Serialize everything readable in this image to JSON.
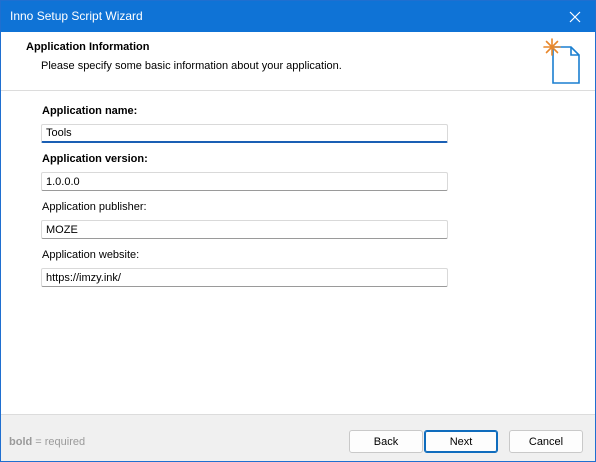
{
  "window": {
    "title": "Inno Setup Script Wizard",
    "close_icon": "close-icon"
  },
  "header": {
    "title": "Application Information",
    "subtitle": "Please specify some basic information about your application.",
    "icon": "new-document-sparkle-icon"
  },
  "form": {
    "app_name": {
      "label": "Application name:",
      "value": "Tools",
      "required": true
    },
    "app_version": {
      "label": "Application version:",
      "value": "1.0.0.0",
      "required": true
    },
    "app_publisher": {
      "label": "Application publisher:",
      "value": "MOZE",
      "required": false
    },
    "app_website": {
      "label": "Application website:",
      "value": "https://imzy.ink/",
      "required": false
    }
  },
  "footer": {
    "legend_bold": "bold",
    "legend_rest": " = required",
    "back_label": "Back",
    "next_label": "Next",
    "cancel_label": "Cancel"
  },
  "colors": {
    "titlebar": "#0f73d6",
    "accent": "#0f6cbd",
    "icon_sparkle": "#e8872a",
    "icon_outline": "#1a7fd0"
  }
}
